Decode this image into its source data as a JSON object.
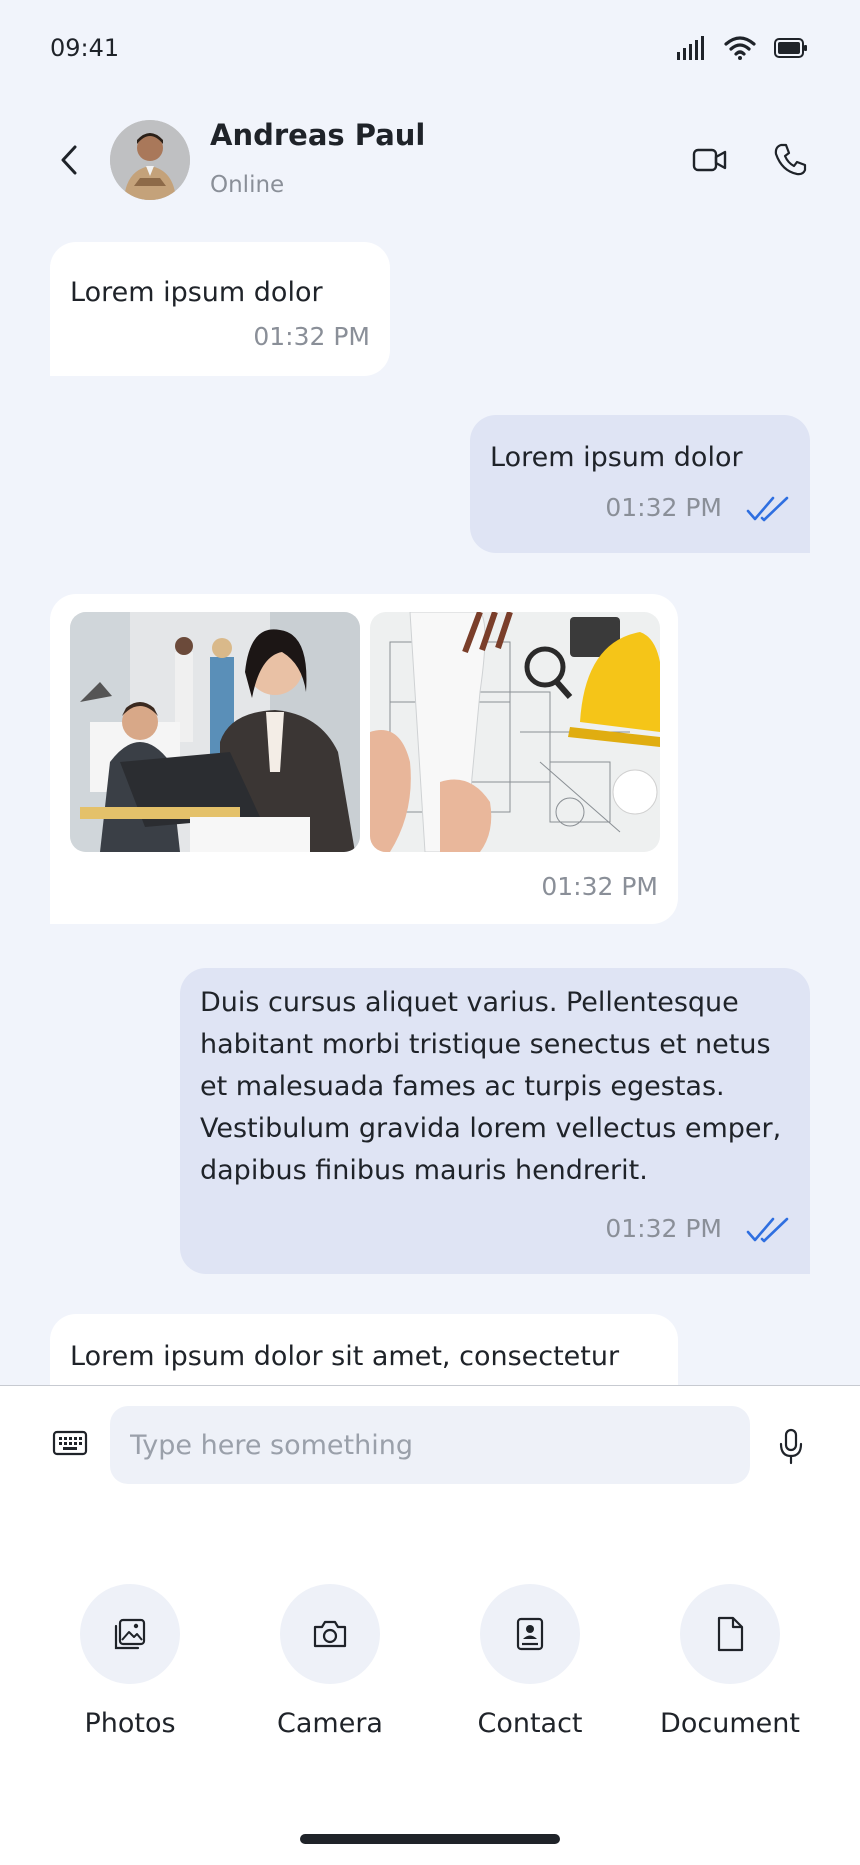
{
  "status_bar": {
    "time": "09:41",
    "icons": [
      "signal-icon",
      "wifi-icon",
      "battery-icon"
    ]
  },
  "header": {
    "contact_name": "Andreas Paul",
    "contact_status": "Online",
    "icons": [
      "back-icon",
      "video-call-icon",
      "phone-call-icon"
    ]
  },
  "messages": [
    {
      "direction": "incoming",
      "text": "Lorem ipsum dolor",
      "time": "01:32 PM"
    },
    {
      "direction": "outgoing",
      "text": "Lorem ipsum dolor",
      "time": "01:32 PM",
      "read": true
    },
    {
      "direction": "incoming",
      "type": "images",
      "images": [
        "office-team-photo",
        "blueprint-helmet-photo"
      ],
      "time": "01:32 PM"
    },
    {
      "direction": "outgoing",
      "text": "Duis cursus aliquet varius. Pellentesque habitant morbi tristique senectus et netus et malesuada fames ac turpis egestas. Vestibulum gravida lorem vellectus emper, dapibus finibus mauris hendrerit.",
      "time": "01:32 PM",
      "read": true
    },
    {
      "direction": "incoming",
      "text": "Lorem ipsum dolor sit amet, consectetur"
    }
  ],
  "composer": {
    "placeholder": "Type here something",
    "value": ""
  },
  "attachments": [
    {
      "label": "Photos",
      "icon": "photos-icon"
    },
    {
      "label": "Camera",
      "icon": "camera-icon"
    },
    {
      "label": "Contact",
      "icon": "contact-icon"
    },
    {
      "label": "Document",
      "icon": "document-icon"
    }
  ],
  "colors": {
    "background": "#f1f4fb",
    "outgoing_bubble": "#dfe4f4",
    "incoming_bubble": "#ffffff",
    "read_ticks": "#2f6fe0"
  }
}
